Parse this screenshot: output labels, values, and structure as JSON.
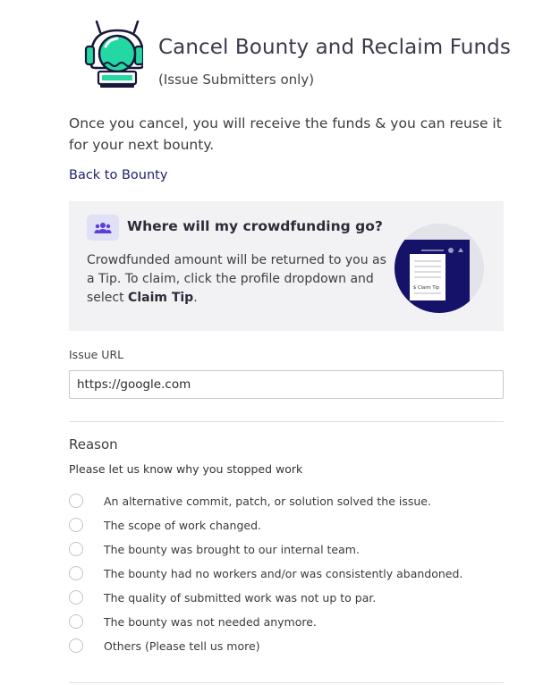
{
  "header": {
    "title": "Cancel Bounty and Reclaim Funds",
    "subtitle": "(Issue Submitters only)"
  },
  "intro": "Once you cancel, you will receive the funds & you can reuse it for your next bounty.",
  "back_link": "Back to Bounty",
  "info": {
    "title": "Where will my crowdfunding go?",
    "text_before": "Crowdfunded amount will be returned to you as a Tip. To claim, click the profile dropdown and select ",
    "text_bold": "Claim Tip",
    "text_after": ".",
    "illustration_label": "$ Claim Tip"
  },
  "issue_url": {
    "label": "Issue URL",
    "value": "https://google.com"
  },
  "reason": {
    "title": "Reason",
    "subtitle": "Please let us know why you stopped work",
    "options": [
      "An alternative commit, patch, or solution solved the issue.",
      "The scope of work changed.",
      "The bounty was brought to our internal team.",
      "The bounty had no workers and/or was consistently abandoned.",
      "The quality of submitted work was not up to par.",
      "The bounty was not needed anymore.",
      "Others (Please tell us more)"
    ]
  },
  "colors": {
    "accent_navy": "#15126a",
    "logo_green": "#23d8a2",
    "link": "#1f1f6e",
    "info_bg": "#f2f2f4"
  }
}
